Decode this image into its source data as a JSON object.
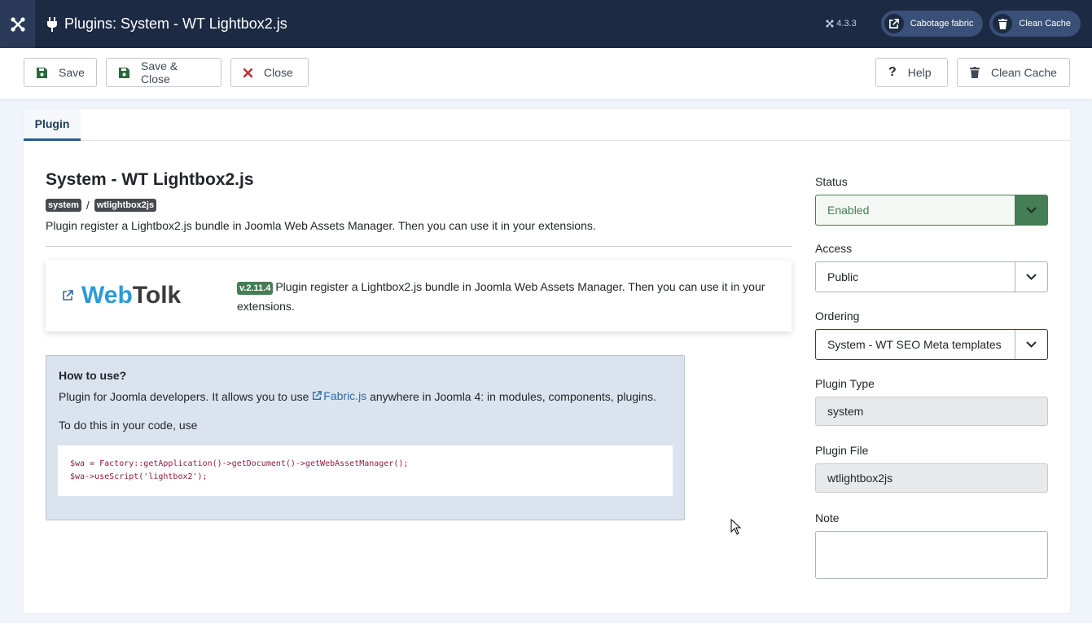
{
  "header": {
    "title": "Plugins: System - WT Lightbox2.js",
    "version": "4.3.3",
    "pill1_label": "Cabotage fabric",
    "pill2_label": "Clean Cache",
    "logo_icon": "joomla-icon",
    "title_icon": "plug-icon"
  },
  "toolbar": {
    "save_label": "Save",
    "save_close_label": "Save & Close",
    "close_label": "Close",
    "help_label": "Help",
    "clean_cache_label": "Clean Cache"
  },
  "tabs": [
    {
      "label": "Plugin"
    }
  ],
  "plugin": {
    "title": "System - WT Lightbox2.js",
    "badge_group": "system",
    "badge_element": "wtlightbox2js",
    "separator": "/",
    "description": "Plugin register a Lightbox2.js bundle in Joomla Web Assets Manager. Then you can use it in your extensions."
  },
  "webtolk": {
    "logo_web": "Web",
    "logo_tolk": "Tolk",
    "version_badge": "v.2.11.4",
    "text": "Plugin register a Lightbox2.js bundle in Joomla Web Assets Manager. Then you can use it in your extensions."
  },
  "howto": {
    "title": "How to use?",
    "line1_before": "Plugin for Joomla developers. It allows you to use ",
    "line1_link": "Fabric.js",
    "line1_after": " anywhere in Joomla 4: in modules, components, plugins.",
    "line2": "To do this in your code, use",
    "code": "$wa = Factory::getApplication()->getDocument()->getWebAssetManager();\n$wa->useScript('lightbox2');"
  },
  "fields": {
    "status_label": "Status",
    "status_value": "Enabled",
    "access_label": "Access",
    "access_value": "Public",
    "ordering_label": "Ordering",
    "ordering_value": "System - WT SEO Meta templates",
    "type_label": "Plugin Type",
    "type_value": "system",
    "file_label": "Plugin File",
    "file_value": "wtlightbox2js",
    "note_label": "Note",
    "note_value": ""
  },
  "colors": {
    "header_bg": "#1c2a43",
    "status_green": "#457d54",
    "link_blue": "#2f6aa6",
    "webtolk_blue": "#2a9ad8"
  }
}
